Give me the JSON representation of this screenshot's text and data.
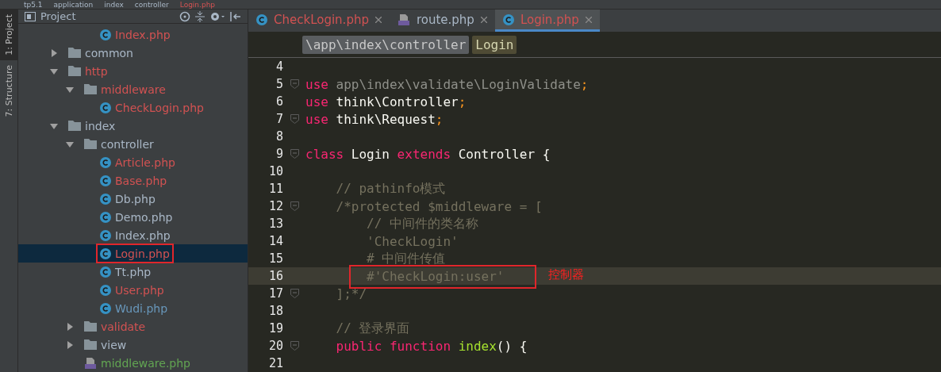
{
  "breadcrumbs": [
    "tp5.1",
    "application",
    "index",
    "controller",
    "Login.php"
  ],
  "tool_strip": [
    {
      "label": "1: Project",
      "selected": true
    },
    {
      "label": "7: Structure",
      "selected": false
    }
  ],
  "project_panel": {
    "title": "Project",
    "cut_rows": [
      {
        "label": "Index.php",
        "kind": "class",
        "color": "#d25252",
        "selected": false,
        "annotated": false
      }
    ],
    "tree": [
      {
        "label": "common",
        "kind": "folder",
        "expanded": false,
        "color": "#a9b7c6",
        "selected": false,
        "annotated": false
      },
      {
        "label": "http",
        "kind": "folder",
        "expanded": true,
        "color": "#d25252",
        "selected": false,
        "annotated": false,
        "children": [
          {
            "label": "middleware",
            "kind": "folder",
            "expanded": true,
            "color": "#d25252",
            "selected": false,
            "annotated": false,
            "children": [
              {
                "label": "CheckLogin.php",
                "kind": "class",
                "color": "#d25252",
                "selected": false,
                "annotated": false
              }
            ]
          }
        ]
      },
      {
        "label": "index",
        "kind": "folder",
        "expanded": true,
        "color": "#a9b7c6",
        "selected": false,
        "annotated": false,
        "children": [
          {
            "label": "controller",
            "kind": "folder",
            "expanded": true,
            "color": "#a9b7c6",
            "selected": false,
            "annotated": false,
            "children": [
              {
                "label": "Article.php",
                "kind": "class",
                "color": "#d25252",
                "selected": false,
                "annotated": false
              },
              {
                "label": "Base.php",
                "kind": "class",
                "color": "#d25252",
                "selected": false,
                "annotated": false
              },
              {
                "label": "Db.php",
                "kind": "class",
                "color": "#a9b7c6",
                "selected": false,
                "annotated": false
              },
              {
                "label": "Demo.php",
                "kind": "class",
                "color": "#a9b7c6",
                "selected": false,
                "annotated": false
              },
              {
                "label": "Index.php",
                "kind": "class",
                "color": "#a9b7c6",
                "selected": false,
                "annotated": false
              },
              {
                "label": "Login.php",
                "kind": "class",
                "color": "#d25252",
                "selected": true,
                "annotated": true
              },
              {
                "label": "Tt.php",
                "kind": "class",
                "color": "#a9b7c6",
                "selected": false,
                "annotated": false
              },
              {
                "label": "User.php",
                "kind": "class",
                "color": "#d25252",
                "selected": false,
                "annotated": false
              },
              {
                "label": "Wudi.php",
                "kind": "class",
                "color": "#6897bb",
                "selected": false,
                "annotated": false
              }
            ]
          },
          {
            "label": "validate",
            "kind": "folder",
            "expanded": false,
            "color": "#d25252",
            "selected": false,
            "annotated": false
          },
          {
            "label": "view",
            "kind": "folder",
            "expanded": false,
            "color": "#a9b7c6",
            "selected": false,
            "annotated": false
          },
          {
            "label": "middleware.php",
            "kind": "php",
            "color": "#62a552",
            "selected": false,
            "annotated": false
          }
        ]
      }
    ]
  },
  "editor_tabs": [
    {
      "label": "CheckLogin.php",
      "kind": "class",
      "color": "#d25252",
      "selected": false
    },
    {
      "label": "route.php",
      "kind": "php",
      "color": "#a9b7c6",
      "selected": false
    },
    {
      "label": "Login.php",
      "kind": "class",
      "color": "#d25252",
      "selected": true
    }
  ],
  "code_breadcrumbs": [
    {
      "label": "\\app\\index\\controller",
      "kind": "namespace"
    },
    {
      "label": "Login",
      "kind": "class"
    }
  ],
  "code_lines": [
    {
      "number": "4",
      "fold": false,
      "current": false,
      "annotated": false
    },
    {
      "number": "5",
      "fold": true,
      "current": false,
      "annotated": false,
      "tokens": [
        {
          "kind": "keyword",
          "text": "use"
        },
        {
          "kind": "dim",
          "text": " app\\index\\validate\\LoginValidate"
        },
        {
          "kind": "punct",
          "text": ";"
        }
      ]
    },
    {
      "number": "6",
      "fold": false,
      "current": false,
      "annotated": false,
      "tokens": [
        {
          "kind": "keyword",
          "text": "use"
        },
        {
          "kind": "plain",
          "text": " think\\Controller"
        },
        {
          "kind": "punct",
          "text": ";"
        }
      ]
    },
    {
      "number": "7",
      "fold": true,
      "current": false,
      "annotated": false,
      "tokens": [
        {
          "kind": "keyword",
          "text": "use"
        },
        {
          "kind": "plain",
          "text": " think\\Request"
        },
        {
          "kind": "punct",
          "text": ";"
        }
      ]
    },
    {
      "number": "8",
      "fold": false,
      "current": false,
      "annotated": false
    },
    {
      "number": "9",
      "fold": true,
      "current": false,
      "annotated": false,
      "tokens": [
        {
          "kind": "keyword",
          "text": "class"
        },
        {
          "kind": "plain",
          "text": " Login "
        },
        {
          "kind": "keyword",
          "text": "extends"
        },
        {
          "kind": "plain",
          "text": " Controller {"
        }
      ]
    },
    {
      "number": "10",
      "fold": false,
      "current": false,
      "annotated": false
    },
    {
      "number": "11",
      "fold": false,
      "current": false,
      "annotated": false,
      "tokens": [
        {
          "kind": "comment",
          "text": "    // pathinfo模式"
        }
      ]
    },
    {
      "number": "12",
      "fold": true,
      "current": false,
      "annotated": false,
      "tokens": [
        {
          "kind": "comment",
          "text": "    /*protected $middleware = ["
        }
      ]
    },
    {
      "number": "13",
      "fold": false,
      "current": false,
      "annotated": false,
      "tokens": [
        {
          "kind": "comment",
          "text": "        // 中间件的类名称"
        }
      ]
    },
    {
      "number": "14",
      "fold": false,
      "current": false,
      "annotated": false,
      "tokens": [
        {
          "kind": "comment",
          "text": "        'CheckLogin'"
        }
      ]
    },
    {
      "number": "15",
      "fold": false,
      "current": false,
      "annotated": false,
      "tokens": [
        {
          "kind": "comment",
          "text": "        # 中间件传值"
        }
      ]
    },
    {
      "number": "16",
      "fold": false,
      "current": true,
      "annotated": true,
      "tokens": [
        {
          "kind": "comment",
          "text": "        #'CheckLogin:user'"
        }
      ]
    },
    {
      "number": "17",
      "fold": true,
      "current": false,
      "annotated": false,
      "tokens": [
        {
          "kind": "comment",
          "text": "    ];*/"
        }
      ]
    },
    {
      "number": "18",
      "fold": false,
      "current": false,
      "annotated": false
    },
    {
      "number": "19",
      "fold": false,
      "current": false,
      "annotated": false,
      "tokens": [
        {
          "kind": "comment",
          "text": "    // 登录界面"
        }
      ]
    },
    {
      "number": "20",
      "fold": true,
      "current": false,
      "annotated": false,
      "tokens": [
        {
          "kind": "keyword",
          "text": "    public function"
        },
        {
          "kind": "function",
          "text": " index"
        },
        {
          "kind": "plain",
          "text": "() {"
        }
      ]
    },
    {
      "number": "21",
      "fold": false,
      "current": false,
      "annotated": false
    }
  ],
  "annotation": {
    "label": "控制器"
  }
}
